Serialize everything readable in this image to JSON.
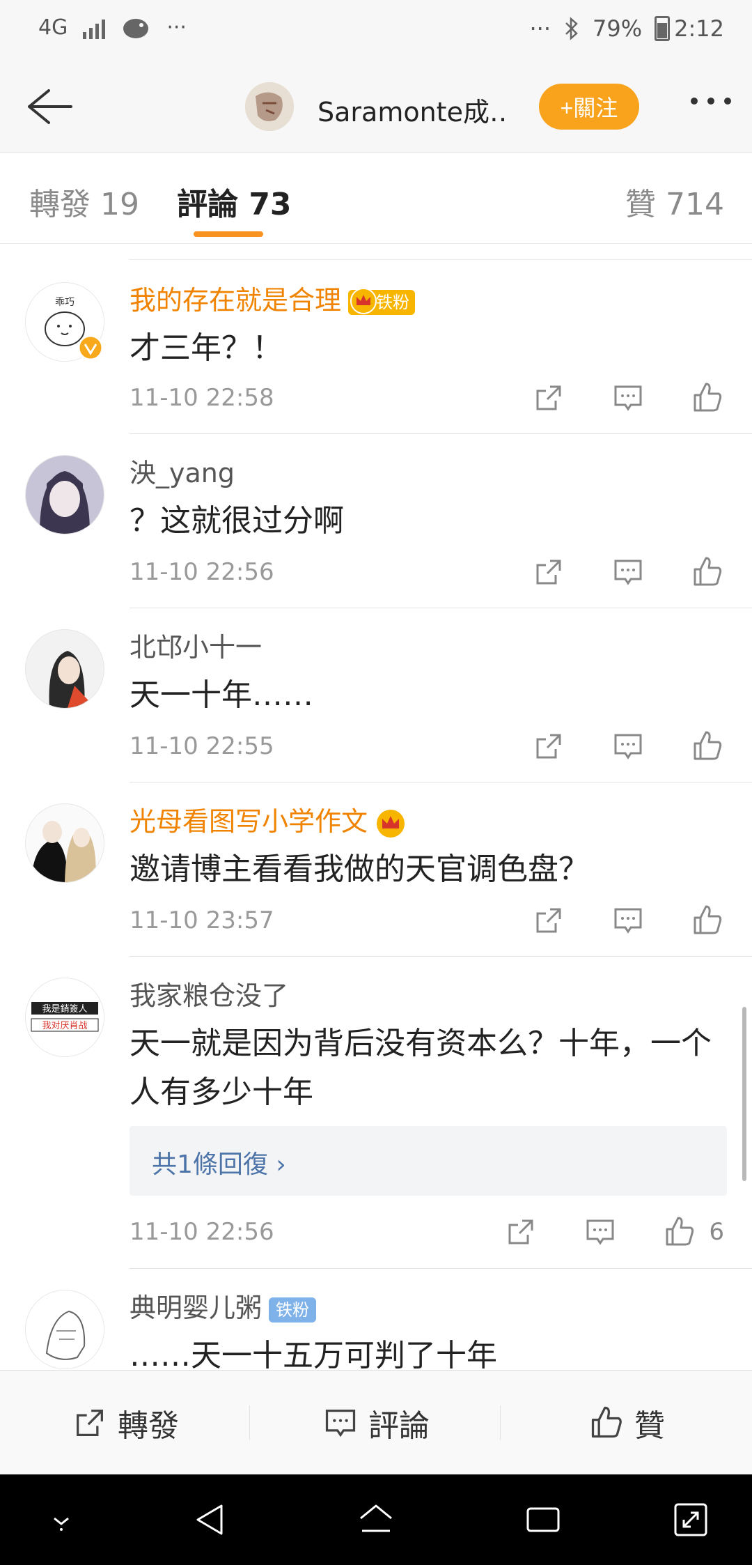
{
  "status_bar": {
    "network": "4G",
    "more_left": "···",
    "more_right": "···",
    "battery": "79%",
    "time": "2:12"
  },
  "header": {
    "title": "Saramonte成…",
    "follow_label": "+關注",
    "accent": "#f9a21c"
  },
  "tabs": {
    "repost": "轉發 19",
    "comments": "評論 73",
    "likes": "贊 714"
  },
  "comments": [
    {
      "name": "我的存在就是合理",
      "badge": "铁粉",
      "badge_type": "crown-fan",
      "text": "才三年？！",
      "time": "11-10 22:58",
      "avatar_text": "乖巧"
    },
    {
      "name": "泱_yang",
      "text": "？这就很过分啊",
      "time": "11-10 22:56"
    },
    {
      "name": "北邙小十一",
      "text": "天一十年……",
      "time": "11-10 22:55"
    },
    {
      "name": "光母看图写小学作文",
      "badge_type": "crown",
      "text": "邀请博主看看我做的天官调色盘？",
      "time": "11-10 23:57"
    },
    {
      "name": "我家粮仓没了",
      "text": "天一就是因为背后没有资本么？十年，一个人有多少十年",
      "reply": "共1條回復 ›",
      "time": "11-10 22:56",
      "likes": "6",
      "avatar_text_1": "我是銷簽人",
      "avatar_text_2": "我对厌肖战"
    },
    {
      "name": "典明婴儿粥",
      "badge": "铁粉",
      "badge_type": "blue-fan",
      "text": "……天一十五万可判了十年"
    }
  ],
  "toolbar": {
    "repost": "轉發",
    "comment": "評論",
    "like": "贊"
  }
}
